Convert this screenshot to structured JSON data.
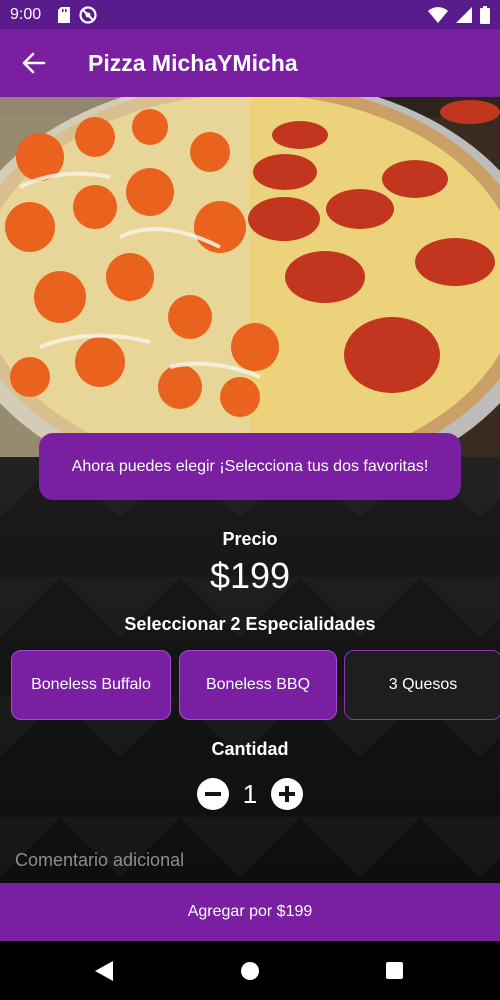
{
  "status_bar": {
    "time": "9:00",
    "icons": [
      "sd-card-icon",
      "do-not-disturb-icon",
      "wifi-icon",
      "signal-icon",
      "battery-icon"
    ]
  },
  "app_bar": {
    "title": "Pizza MichaYMicha",
    "back_icon": "arrow-left-icon"
  },
  "hero": {
    "image": "pizza-half-boneless-half-pepperoni"
  },
  "promo": {
    "text": "Ahora puedes elegir ¡Selecciona tus dos favoritas!"
  },
  "price": {
    "label": "Precio",
    "value": "$199"
  },
  "specialties": {
    "label": "Seleccionar 2 Especialidades",
    "options": [
      {
        "label": "Boneless Buffalo",
        "selected": true
      },
      {
        "label": "Boneless BBQ",
        "selected": true
      },
      {
        "label": "3 Quesos",
        "selected": false
      }
    ]
  },
  "quantity": {
    "label": "Cantidad",
    "value": "1",
    "decrement_icon": "minus-circle-icon",
    "increment_icon": "plus-circle-icon"
  },
  "comment": {
    "placeholder": "Comentario adicional",
    "value": ""
  },
  "add_button": {
    "label": "Agregar por $199"
  },
  "nav_bar": {
    "icons": [
      "back-triangle-icon",
      "home-circle-icon",
      "recents-square-icon"
    ]
  },
  "colors": {
    "primary": "#7a1fa2",
    "status_bar": "#5a1b8d",
    "background": "#151515",
    "text": "#ffffff"
  }
}
